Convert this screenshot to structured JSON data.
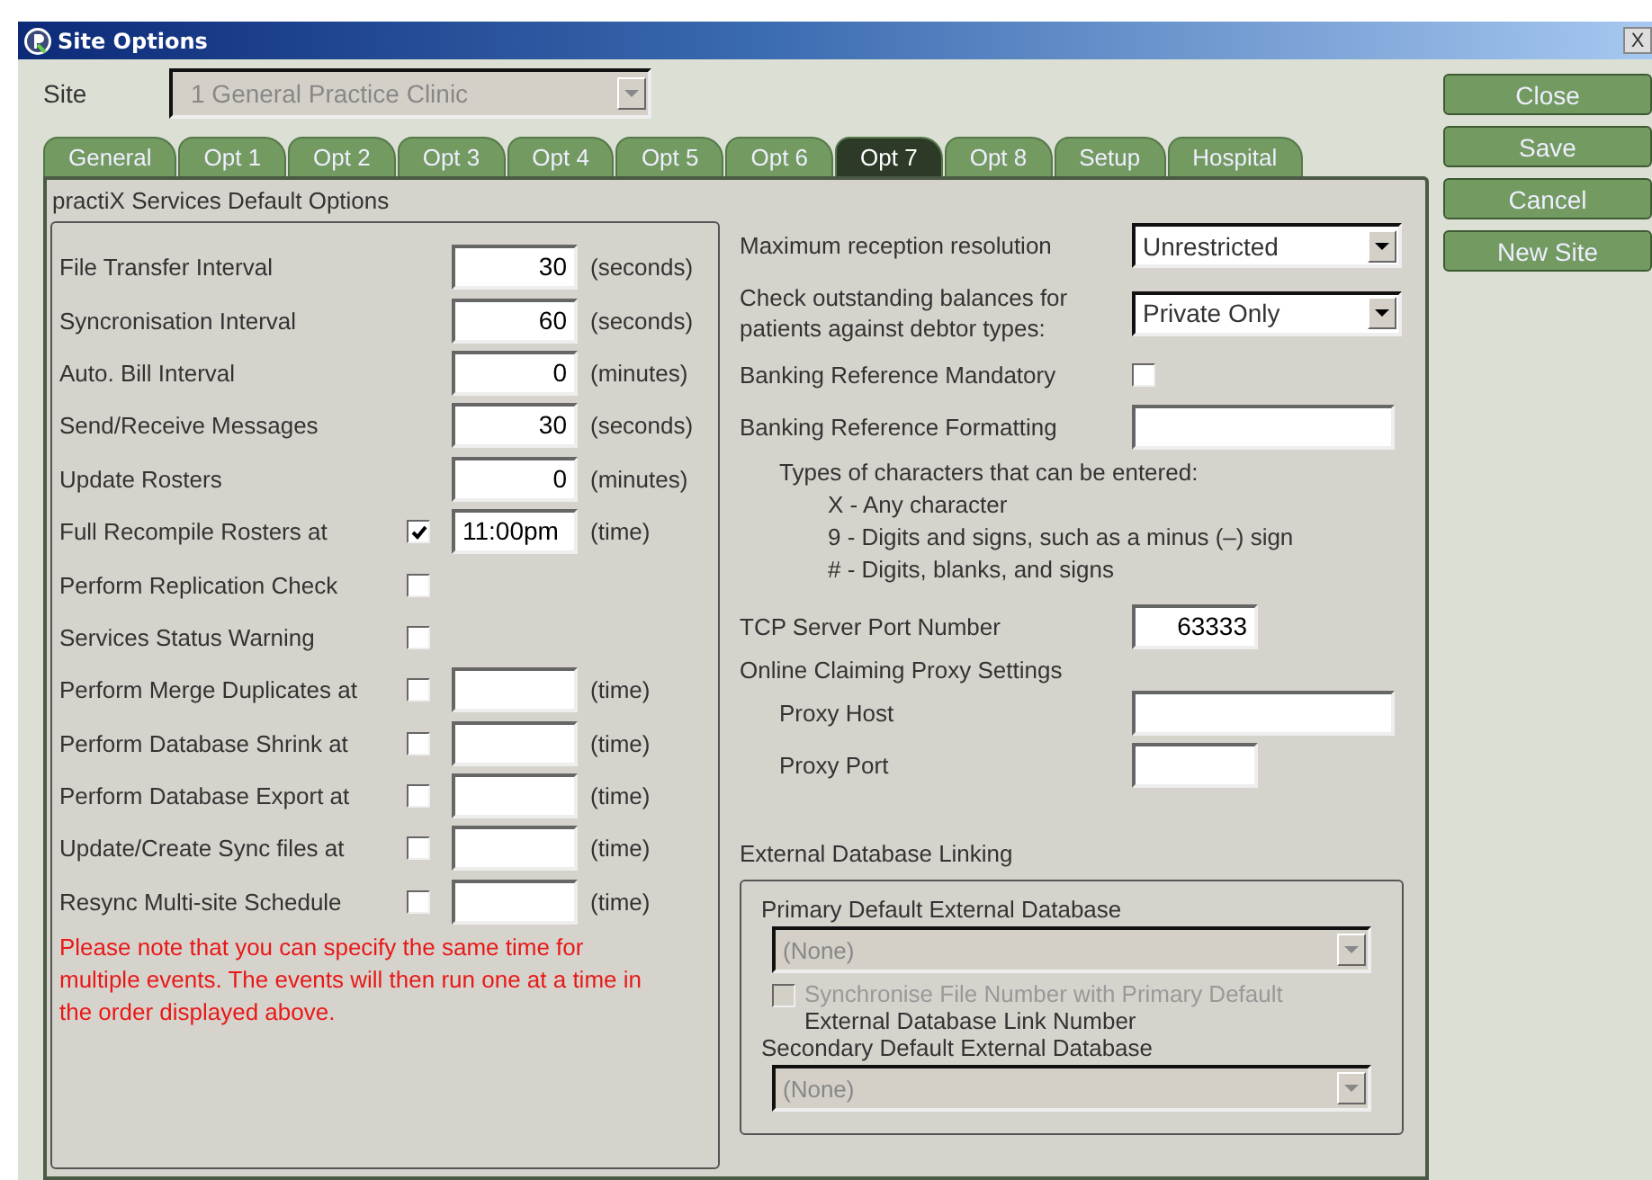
{
  "window": {
    "title": "Site Options",
    "close": "X"
  },
  "site": {
    "label": "Site",
    "value": "1  General Practice Clinic",
    "disabled": true
  },
  "tabs": [
    {
      "label": "General",
      "selected": false
    },
    {
      "label": "Opt 1",
      "selected": false
    },
    {
      "label": "Opt 2",
      "selected": false
    },
    {
      "label": "Opt 3",
      "selected": false
    },
    {
      "label": "Opt 4",
      "selected": false
    },
    {
      "label": "Opt 5",
      "selected": false
    },
    {
      "label": "Opt 6",
      "selected": false
    },
    {
      "label": "Opt 7",
      "selected": true
    },
    {
      "label": "Opt 8",
      "selected": false
    },
    {
      "label": "Setup",
      "selected": false
    },
    {
      "label": "Hospital",
      "selected": false
    }
  ],
  "buttons": [
    {
      "label": "Close"
    },
    {
      "label": "Save"
    },
    {
      "label": "Cancel"
    },
    {
      "label": "New Site"
    }
  ],
  "services": {
    "title": "practiX Services Default Options",
    "rows": [
      {
        "kind": "number",
        "label": "File Transfer Interval",
        "value": "30",
        "unit": "(seconds)"
      },
      {
        "kind": "number",
        "label": "Syncronisation Interval",
        "value": "60",
        "unit": "(seconds)"
      },
      {
        "kind": "number",
        "label": "Auto. Bill Interval",
        "value": "0",
        "unit": "(minutes)"
      },
      {
        "kind": "number",
        "label": "Send/Receive Messages",
        "value": "30",
        "unit": "(seconds)"
      },
      {
        "kind": "number",
        "label": "Update Rosters",
        "value": "0",
        "unit": "(minutes)"
      },
      {
        "kind": "check_time",
        "label": "Full Recompile Rosters at",
        "checked": true,
        "value": "11:00pm",
        "unit": "(time)"
      },
      {
        "kind": "check",
        "label": "Perform Replication Check",
        "checked": false
      },
      {
        "kind": "check",
        "label": "Services Status Warning",
        "checked": false
      },
      {
        "kind": "check_time",
        "label": "Perform Merge Duplicates at",
        "checked": false,
        "unit": "(time)"
      },
      {
        "kind": "check_time",
        "label": "Perform Database Shrink at",
        "checked": false,
        "unit": "(time)"
      },
      {
        "kind": "check_time",
        "label": "Perform Database Export at",
        "checked": false,
        "unit": "(time)"
      },
      {
        "kind": "check_time",
        "label": "Update/Create Sync files at",
        "checked": false,
        "unit": "(time)"
      },
      {
        "kind": "check_time",
        "label": "Resync Multi-site Schedule",
        "checked": false,
        "unit": "(time)"
      }
    ],
    "note": "Please note that you can specify the same time for multiple events. The events will then run one at a time in the order displayed above."
  },
  "reception": {
    "label": "Maximum reception resolution",
    "value": "Unrestricted"
  },
  "balances": {
    "label": "Check outstanding balances for patients against debtor types:",
    "value": "Private Only"
  },
  "banking_mandatory": {
    "label": "Banking Reference Mandatory",
    "checked": false
  },
  "banking_format": {
    "label": "Banking Reference Formatting",
    "help_title": "Types of characters that can be entered:",
    "help_lines": [
      "X - Any character",
      "9 - Digits and signs, such as a minus (–) sign",
      "# - Digits, blanks, and signs"
    ]
  },
  "tcp_port": {
    "label": "TCP Server Port Number",
    "value": "63333"
  },
  "proxy": {
    "title": "Online Claiming Proxy Settings",
    "host_label": "Proxy Host",
    "port_label": "Proxy Port"
  },
  "external": {
    "title": "External Database Linking",
    "primary_label": "Primary Default External Database",
    "primary_value": "(None)",
    "primary_disabled": true,
    "sync": {
      "label": "Synchronise File Number with Primary Default",
      "label_continued": "External Database Link Number",
      "checked": false,
      "disabled": true
    },
    "secondary_label": "Secondary Default External Database",
    "secondary_value": "(None)",
    "secondary_disabled": true
  }
}
